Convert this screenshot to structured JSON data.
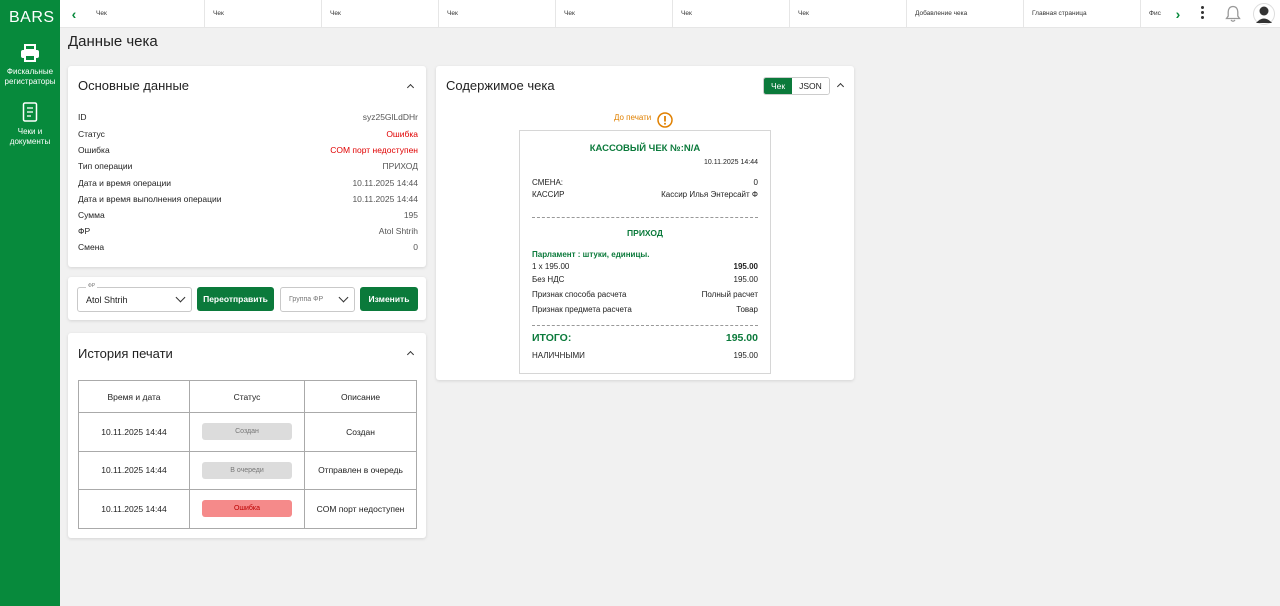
{
  "sidebar": {
    "logo": "BARS",
    "items": [
      {
        "label": "Фискальные регистраторы",
        "icon": "printer-icon"
      },
      {
        "label": "Чеки и документы",
        "icon": "document-icon"
      }
    ]
  },
  "topbar": {
    "tabs": [
      "Чек",
      "Чек",
      "Чек",
      "Чек",
      "Чек",
      "Чек",
      "Чек",
      "Добавление чека",
      "Главная страница",
      "Фис"
    ]
  },
  "page_title": "Данные чека",
  "main_data": {
    "title": "Основные данные",
    "rows": [
      {
        "key": "ID",
        "value": "syz25GlLdDHr"
      },
      {
        "key": "Статус",
        "value": "Ошибка"
      },
      {
        "key": "Ошибка",
        "value": "COM порт недоступен"
      },
      {
        "key": "Тип операции",
        "value": "ПРИХОД"
      },
      {
        "key": "Дата и время операции",
        "value": "10.11.2025 14:44"
      },
      {
        "key": "Дата и время выполнения операции",
        "value": "10.11.2025 14:44"
      },
      {
        "key": "Сумма",
        "value": "195"
      },
      {
        "key": "ФР",
        "value": "Atol Shtrih"
      },
      {
        "key": "Смена",
        "value": "0"
      }
    ]
  },
  "controls": {
    "fr_label": "ФР",
    "fr_value": "Atol Shtrih",
    "resend_label": "Переотправить",
    "group_placeholder": "Группа ФР",
    "change_label": "Изменить"
  },
  "history": {
    "title": "История печати",
    "columns": [
      "Время и дата",
      "Статус",
      "Описание"
    ],
    "rows": [
      {
        "time": "10.11.2025 14:44",
        "status": "Создан",
        "description": "Создан"
      },
      {
        "time": "10.11.2025 14:44",
        "status": "В очереди",
        "description": "Отправлен в очередь"
      },
      {
        "time": "10.11.2025 14:44",
        "status": "Ошибка",
        "description": "COM порт недоступен"
      }
    ]
  },
  "receipt_card": {
    "title": "Содержимое чека",
    "toggle": [
      "Чек",
      "JSON"
    ],
    "before_print": "До печати",
    "receipt": {
      "header": "КАССОВЫЙ ЧЕК №:N/A",
      "datetime": "10.11.2025 14:44",
      "shift_label": "СМЕНА:",
      "shift_value": "0",
      "cashier_label": "КАССИР",
      "cashier_value": "Кассир Илья Энтерсайт Ф",
      "operation": "ПРИХОД",
      "item_name": "Парламент : штуки, единицы.",
      "item_qty": "1 x 195.00",
      "item_sum": "195.00",
      "vat_label": "Без НДС",
      "vat_value": "195.00",
      "payment_method_label": "Признак способа расчета",
      "payment_method_value": "Полный расчет",
      "subject_label": "Признак предмета расчета",
      "subject_value": "Товар",
      "total_label": "ИТОГО:",
      "total_value": "195.00",
      "cash_label": "НАЛИЧНЫМИ",
      "cash_value": "195.00"
    }
  },
  "colors": {
    "brand_green": "#078a3c",
    "button_green": "#0b7a3b",
    "error_red": "#e00000",
    "warning_orange": "#e08000"
  }
}
